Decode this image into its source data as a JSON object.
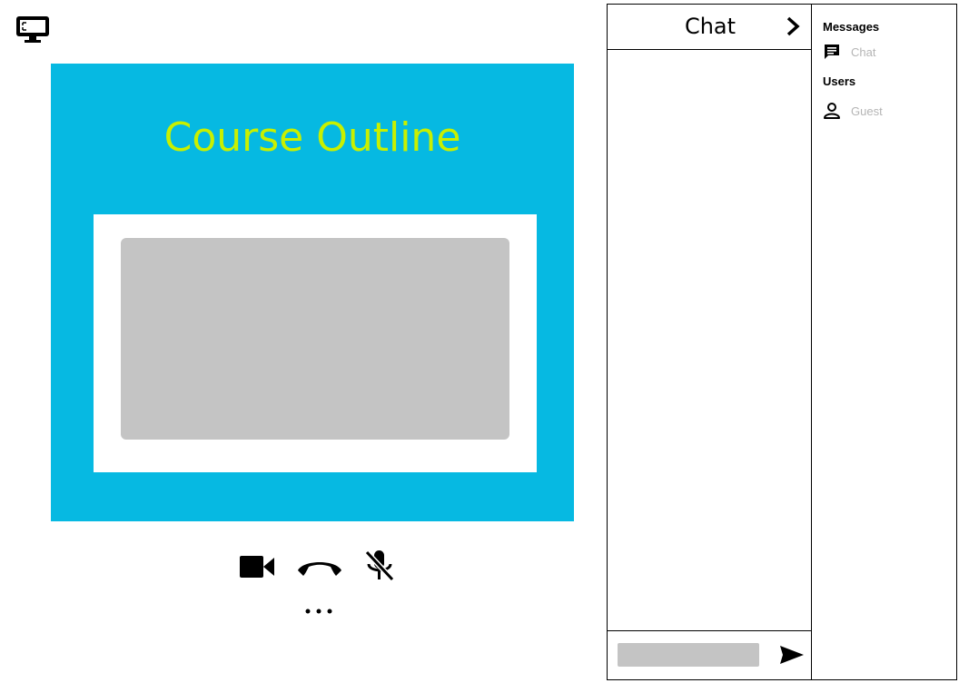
{
  "toolbar": {
    "display_icon": "monitor-screen-icon"
  },
  "slide": {
    "title": "Course Outline",
    "background_color": "#06b9e2",
    "title_color": "#c8f000",
    "image_placeholder_color": "#c4c4c4"
  },
  "controls": {
    "video_icon": "video-camera-icon",
    "hangup_icon": "phone-hangup-icon",
    "mute_icon": "microphone-off-icon",
    "more_icon": "more-horizontal-icon"
  },
  "chat": {
    "title": "Chat",
    "collapse_icon": "chevron-right-icon",
    "input_value": "",
    "input_placeholder": "",
    "send_icon": "send-icon"
  },
  "sidebar": {
    "messages_heading": "Messages",
    "messages_items": [
      {
        "label": "Chat",
        "icon": "chat-message-icon"
      }
    ],
    "users_heading": "Users",
    "users_items": [
      {
        "label": "Guest",
        "icon": "user-icon"
      }
    ]
  }
}
